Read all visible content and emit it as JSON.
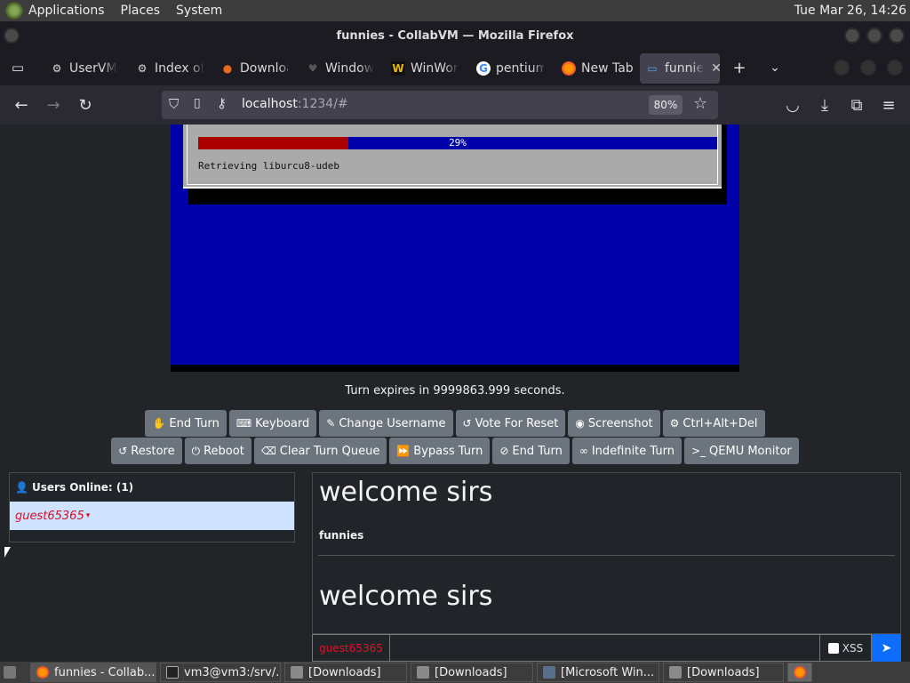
{
  "top_panel": {
    "menus": [
      "Applications",
      "Places",
      "System"
    ],
    "clock": "Tue Mar 26, 14:26"
  },
  "window": {
    "title": "funnies - CollabVM — Mozilla Firefox"
  },
  "tabs": [
    {
      "label": "UserVM",
      "icon": "uservm-icon"
    },
    {
      "label": "Index of",
      "icon": "index-icon"
    },
    {
      "label": "Downloa",
      "icon": "download-icon"
    },
    {
      "label": "Window",
      "icon": "heart-icon"
    },
    {
      "label": "WinWor",
      "icon": "winworld-icon"
    },
    {
      "label": "pentium",
      "icon": "google-icon"
    },
    {
      "label": "New Tab",
      "icon": "firefox-icon"
    },
    {
      "label": "funnie",
      "icon": "monitor-icon"
    }
  ],
  "navbar": {
    "url_host": "localhost",
    "url_rest": ":1234/#",
    "zoom": "80%"
  },
  "vm": {
    "progress_label": "29%",
    "progress": 0.29,
    "status_text": "Retrieving liburcu8-udeb"
  },
  "turn_message": "Turn expires in 9999863.999 seconds.",
  "buttons_row1": [
    {
      "label": "End Turn",
      "icon": "hand-icon"
    },
    {
      "label": "Keyboard",
      "icon": "keyboard-icon"
    },
    {
      "label": "Change Username",
      "icon": "person-edit-icon"
    },
    {
      "label": "Vote For Reset",
      "icon": "reset-icon"
    },
    {
      "label": "Screenshot",
      "icon": "camera-icon"
    },
    {
      "label": "Ctrl+Alt+Del",
      "icon": "gear-icon"
    }
  ],
  "buttons_row2": [
    {
      "label": "Restore",
      "icon": "restore-icon"
    },
    {
      "label": "Reboot",
      "icon": "power-icon"
    },
    {
      "label": "Clear Turn Queue",
      "icon": "eraser-icon"
    },
    {
      "label": "Bypass Turn",
      "icon": "fast-forward-icon"
    },
    {
      "label": "End Turn",
      "icon": "stop-icon"
    },
    {
      "label": "Indefinite Turn",
      "icon": "infinity-icon"
    },
    {
      "label": "QEMU Monitor",
      "icon": "terminal-icon"
    }
  ],
  "users": {
    "header": "Users Online: (1)",
    "list": [
      "guest65365"
    ]
  },
  "chat": {
    "messages": [
      {
        "heading": "welcome sirs"
      },
      {
        "from": "funnies"
      },
      {
        "heading": "welcome sirs"
      }
    ],
    "username": "guest65365",
    "input_value": "",
    "xss_label": "XSS"
  },
  "taskbar": [
    {
      "label": "funnies - Collab...",
      "icon": "firefox-icon"
    },
    {
      "label": "vm3@vm3:/srv/...",
      "icon": "terminal-icon"
    },
    {
      "label": "[Downloads]",
      "icon": "folder-icon"
    },
    {
      "label": "[Downloads]",
      "icon": "folder-icon"
    },
    {
      "label": "[Microsoft Win...",
      "icon": "window-icon"
    },
    {
      "label": "[Downloads]",
      "icon": "folder-icon"
    }
  ]
}
